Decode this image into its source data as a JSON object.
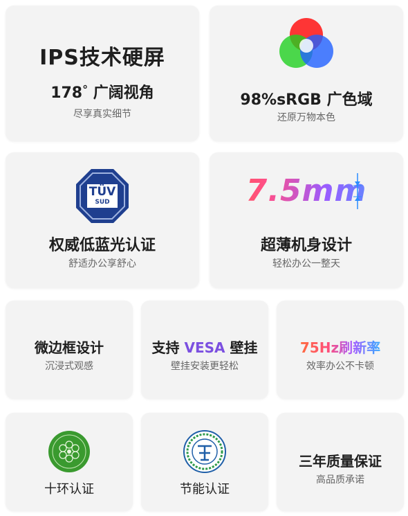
{
  "cards": {
    "ips": {
      "title": "IPS技术硬屏",
      "subtitle_num": "178",
      "subtitle_deg": "°",
      "subtitle_text": " 广阔视角",
      "desc": "尽享真实细节"
    },
    "srgb": {
      "title": "98%sRGB 广色域",
      "desc": "还原万物本色",
      "icon": "rgb-color-circles-icon"
    },
    "tuv": {
      "logo_top": "TÜV",
      "logo_bottom": "SUD",
      "title": "权威低蓝光认证",
      "desc": "舒适办公享舒心",
      "icon": "tuv-certification-icon"
    },
    "thin": {
      "big": "7.5mm",
      "title": "超薄机身设计",
      "desc": "轻松办公一整天"
    },
    "bezel": {
      "title": "微边框设计",
      "desc": "沉浸式观感"
    },
    "vesa": {
      "title_pre": "支持 ",
      "title_accent": "VESA",
      "title_post": " 壁挂",
      "desc": "壁挂安装更轻松"
    },
    "hz": {
      "title": "75Hz刷新率",
      "desc": "效率办公不卡顿"
    },
    "ten_ring": {
      "title": "十环认证",
      "icon": "china-environmental-label-icon"
    },
    "energy": {
      "title": "节能认证",
      "icon": "energy-saving-cert-icon"
    },
    "warranty": {
      "title": "三年质量保证",
      "desc": "高品质承诺"
    }
  },
  "colors": {
    "card_bg": "#f3f3f3",
    "vesa_accent": "#7b4fe0",
    "tuv_blue": "#1f3f8f",
    "ring_green": "#3a9a2f"
  }
}
